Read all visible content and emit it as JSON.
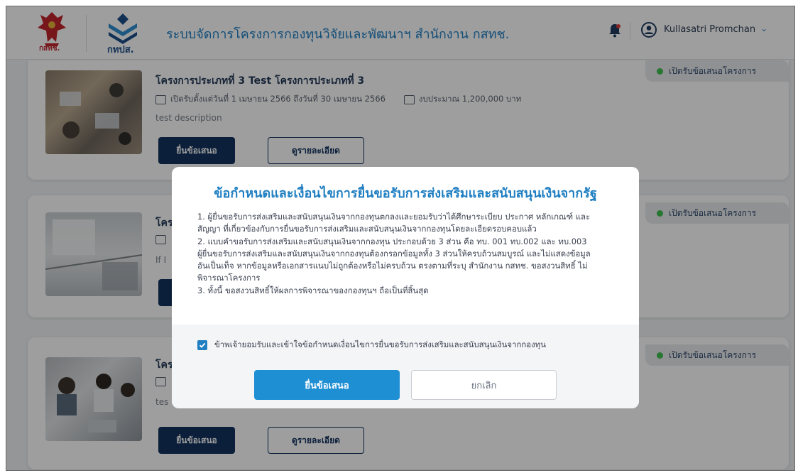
{
  "header": {
    "logo_left_text": "กสทช.",
    "logo_right_text": "กทปส.",
    "app_title": "ระบบจัดการโครงการกองทุนวิจัยและพัฒนาฯ สำนักงาน กสทช.",
    "user_name": "Kullasatri Promchan"
  },
  "cards": [
    {
      "title": "โครงการประเภทที่ 3 Test โครงการประเภทที่ 3",
      "period": "เปิดรับตั้งแต่วันที่ 1 เมษายน 2566 ถึงวันที่ 30 เมษายน 2566",
      "budget": "งบประมาณ 1,200,000 บาท",
      "description": "test description",
      "status": "เปิดรับข้อเสนอโครงการ",
      "submit_label": "ยื่นข้อเสนอ",
      "detail_label": "ดูรายละเอียด"
    },
    {
      "title": "โคร",
      "description": "If I",
      "status": "เปิดรับข้อเสนอโครงการ"
    },
    {
      "title": "โคร",
      "description": "tes",
      "status": "เปิดรับข้อเสนอโครงการ",
      "submit_label": "ยื่นข้อเสนอ",
      "detail_label": "ดูรายละเอียด"
    }
  ],
  "modal": {
    "title": "ข้อกำหนดและเงื่อนไขการยื่นขอรับการส่งเสริมและสนับสนุนเงินจากรัฐ",
    "lines": [
      "1. ผู้ยื่นขอรับการส่งเสริมและสนับสนุนเงินจากกองทุนตกลงและยอมรับว่าได้ศึกษาระเบียบ ประกาศ หลักเกณฑ์ และ",
      "สัญญา ที่เกี่ยวข้องกับการยื่นขอรับการส่งเสริมและสนับสนุนเงินจากกองทุนโดยละเอียดรอบคอบแล้ว",
      "2. แบบคำขอรับการส่งเสริมและสนับสนุนเงินจากกองทุน ประกอบด้วย 3 ส่วน คือ ทบ. 001 ทบ.002 และ ทบ.003",
      "ผู้ยื่นขอรับการส่งเสริมและสนับสนุนเงินจากกองทุนต้องกรอกข้อมูลทั้ง 3 ส่วนให้ครบถ้วนสมบูรณ์ และไม่แสดงข้อมูล",
      "อันเป็นเท็จ หากข้อมูลหรือเอกสารแนบไม่ถูกต้องหรือไม่ครบถ้วน ตรงตามที่ระบุ สำนักงาน กสทช. ขอสงวนสิทธิ์ ไม่",
      "พิจารณาโครงการ",
      "3. ทั้งนี้ ขอสงวนสิทธิ์ให้ผลการพิจารณาของกองทุนฯ ถือเป็นที่สิ้นสุด"
    ],
    "agree_label": "ข้าพเจ้ายอมรับและเข้าใจข้อกำหนดเงื่อนไขการยื่นขอรับการส่งเสริมและสนับสนุนเงินจากกองทุน",
    "agree_checked": true,
    "submit_label": "ยื่นข้อเสนอ",
    "cancel_label": "ยกเลิก"
  },
  "colors": {
    "brand_blue": "#1f7fc2",
    "navy": "#12335e",
    "status_green": "#3fbf4f"
  }
}
